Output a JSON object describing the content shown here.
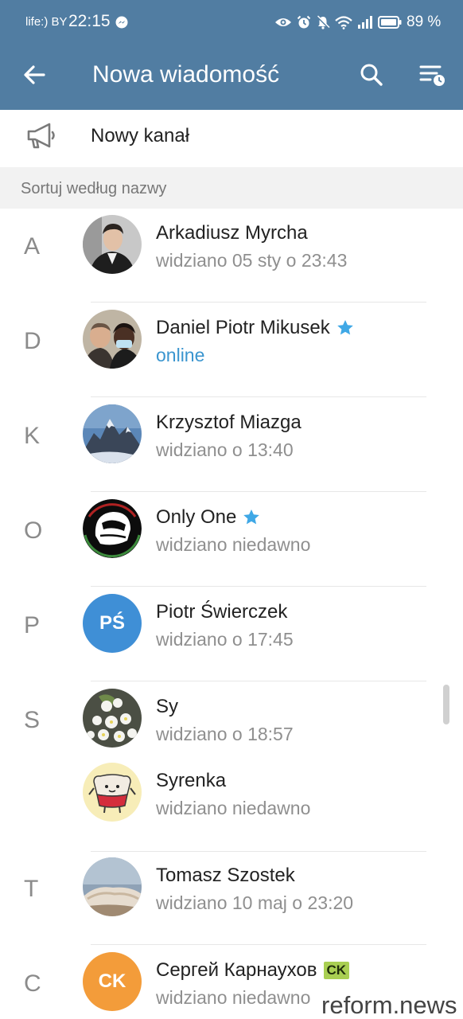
{
  "status_bar": {
    "carrier": "life:) BY",
    "time": "22:15",
    "battery_percent": "89 %",
    "icons": [
      "messenger-icon",
      "eye-icon",
      "alarm-icon",
      "mute-icon",
      "wifi-icon",
      "signal-icon",
      "battery-icon"
    ]
  },
  "toolbar": {
    "title": "Nowa wiadomość",
    "back_icon": "arrow-left-icon",
    "search_icon": "search-icon",
    "sort_icon": "sort-clock-icon",
    "background": "#517da2"
  },
  "new_channel": {
    "label": "Nowy kanał",
    "icon": "megaphone-icon"
  },
  "sort_section": {
    "label": "Sortuj według nazwy"
  },
  "contacts": [
    {
      "letter": "A",
      "name": "Arkadiusz Myrcha",
      "status": "widziano 05 sty o 23:43",
      "online": false,
      "verified": false
    },
    {
      "letter": "D",
      "name": "Daniel Piotr Mikusek",
      "status": "online",
      "online": true,
      "verified": true
    },
    {
      "letter": "K",
      "name": "Krzysztof Miazga",
      "status": "widziano o 13:40",
      "online": false,
      "verified": false
    },
    {
      "letter": "O",
      "name": "Only One",
      "status": "widziano niedawno",
      "online": false,
      "verified": true
    },
    {
      "letter": "P",
      "name": "Piotr Świerczek",
      "status": "widziano o 17:45",
      "online": false,
      "verified": false,
      "initials": "PŚ",
      "avatar_color": "#3f8fd6"
    },
    {
      "letter": "S",
      "name": "Sy",
      "status": "widziano o 18:57",
      "online": false,
      "verified": false
    },
    {
      "letter": "",
      "name": "Syrenka",
      "status": "widziano niedawno",
      "online": false,
      "verified": false
    },
    {
      "letter": "T",
      "name": "Tomasz Szostek",
      "status": "widziano 10 maj o 23:20",
      "online": false,
      "verified": false
    },
    {
      "letter": "C",
      "name": "Сергей Карнаухов",
      "status": "widziano niedawno",
      "online": false,
      "verified": false,
      "badge": "CK",
      "initials": "CK",
      "avatar_color": "#f39c3a"
    }
  ],
  "colors": {
    "accent": "#517da2",
    "online": "#3a95cf",
    "verified_star": "#3fa8e6",
    "badge": "#a9cf52"
  },
  "watermark": "reform.news"
}
